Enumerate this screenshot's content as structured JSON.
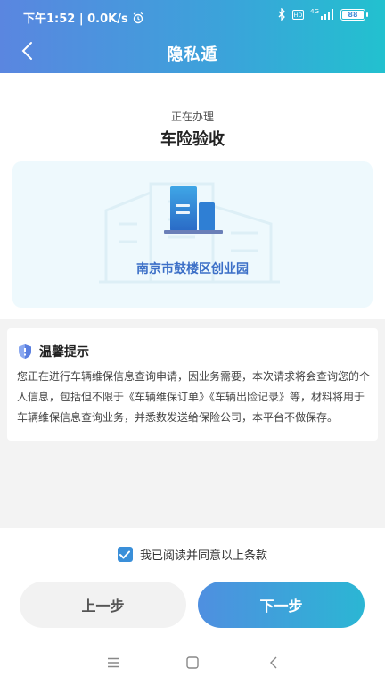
{
  "statusbar": {
    "time_speed": "下午1:52 | 0.0K/s",
    "battery": "88",
    "network": "4G"
  },
  "header": {
    "title": "隐私遁"
  },
  "business": {
    "subtitle": "正在办理",
    "name": "车险验收",
    "location": "南京市鼓楼区创业园"
  },
  "tip": {
    "title": "温馨提示",
    "body": "您正在进行车辆维保信息查询申请，因业务需要，本次请求将会查询您的个人信息，包括但不限于《车辆维保订单》《车辆出险记录》等，材料将用于车辆维保信息查询业务，并悉数发送给保险公司，本平台不做保存。"
  },
  "agreement": {
    "label": "我已阅读并同意以上条款",
    "checked": true
  },
  "buttons": {
    "prev": "上一步",
    "next": "下一步"
  },
  "colors": {
    "accent": "#3a8fd9",
    "header_start": "#5a86e0",
    "header_end": "#22c1cf",
    "location_text": "#3b6fc7"
  }
}
